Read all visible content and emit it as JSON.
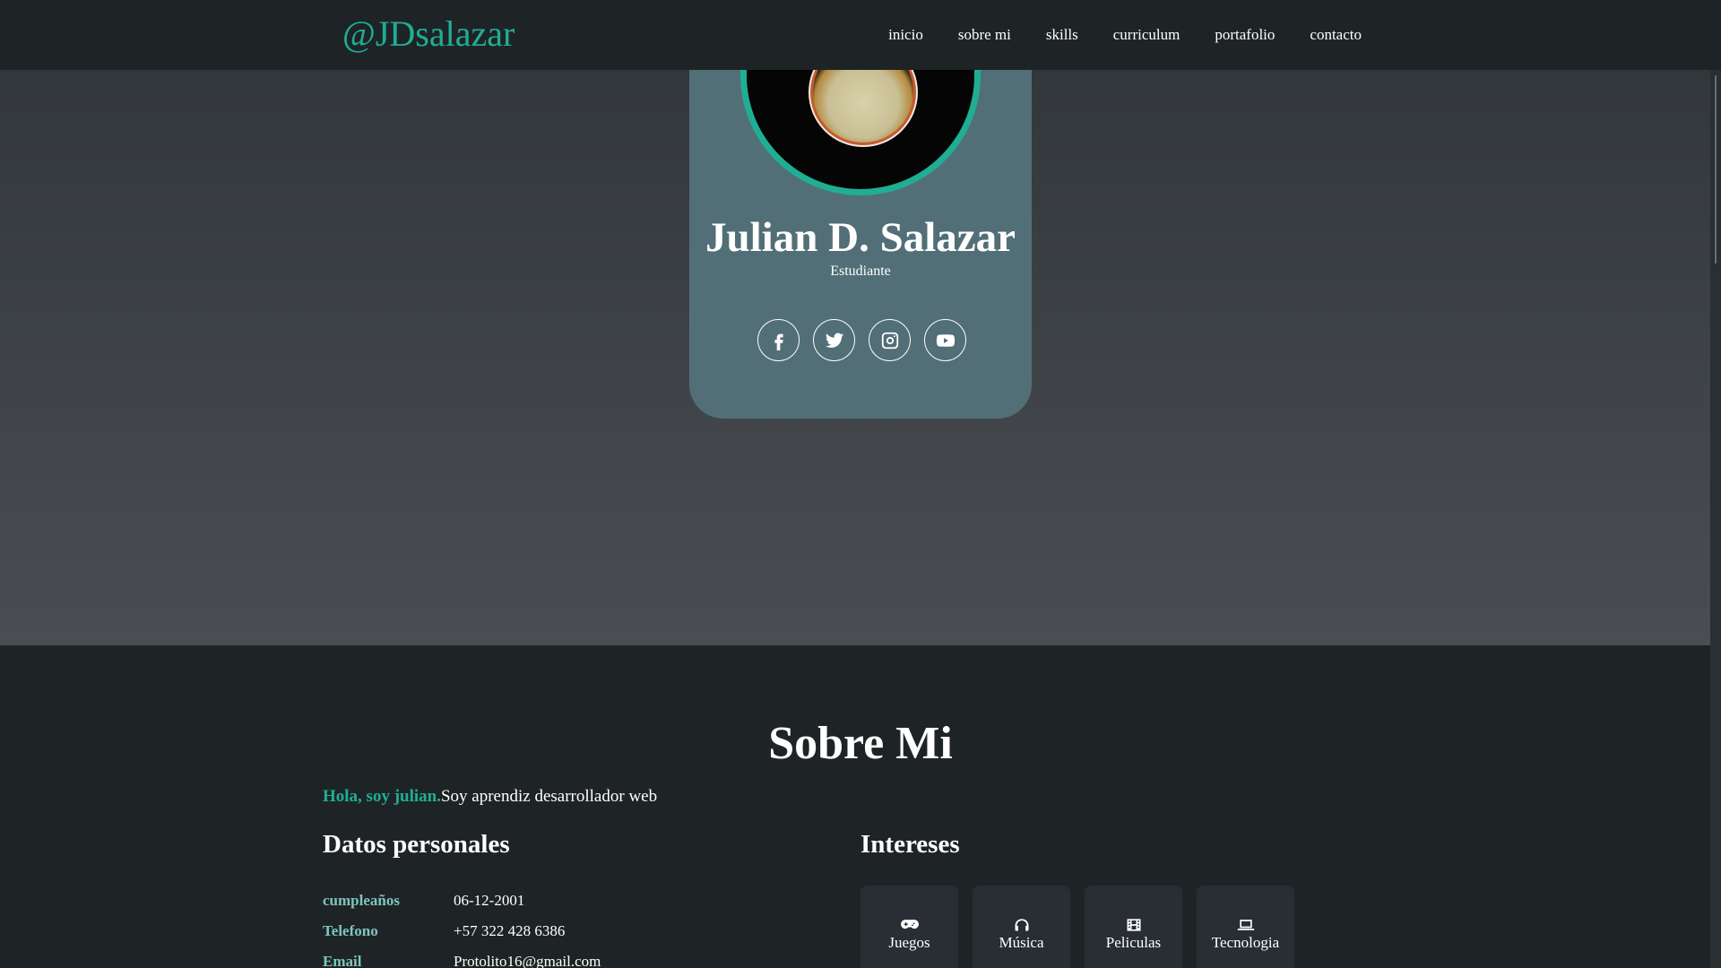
{
  "header": {
    "brand": "@JDsalazar",
    "nav": [
      "inicio",
      "sobre mi",
      "skills",
      "curriculum",
      "portafolio",
      "contacto"
    ]
  },
  "profile": {
    "name": "Julian D. Salazar",
    "role": "Estudiante",
    "socials": [
      "facebook-icon",
      "twitter-icon",
      "instagram-icon",
      "youtube-icon"
    ]
  },
  "about": {
    "title": "Sobre Mi",
    "greeting": "Hola, soy julian.",
    "intro": "Soy aprendiz desarrollador web",
    "personal_title": "Datos personales",
    "interests_title": "Intereses",
    "details": [
      {
        "label": "cumpleaños",
        "value": "06-12-2001"
      },
      {
        "label": "Telefono",
        "value": "+57 322 428 6386"
      },
      {
        "label": "Email",
        "value": "Protolito16@gmail.com"
      }
    ],
    "interests": [
      {
        "label": "Juegos",
        "icon": "gamepad-icon"
      },
      {
        "label": "Música",
        "icon": "headphones-icon"
      },
      {
        "label": "Peliculas",
        "icon": "film-icon"
      },
      {
        "label": "Tecnologia",
        "icon": "laptop-icon"
      }
    ]
  },
  "colors": {
    "accent": "#1fae94",
    "card": "#526f77",
    "background": "#1e2426"
  }
}
